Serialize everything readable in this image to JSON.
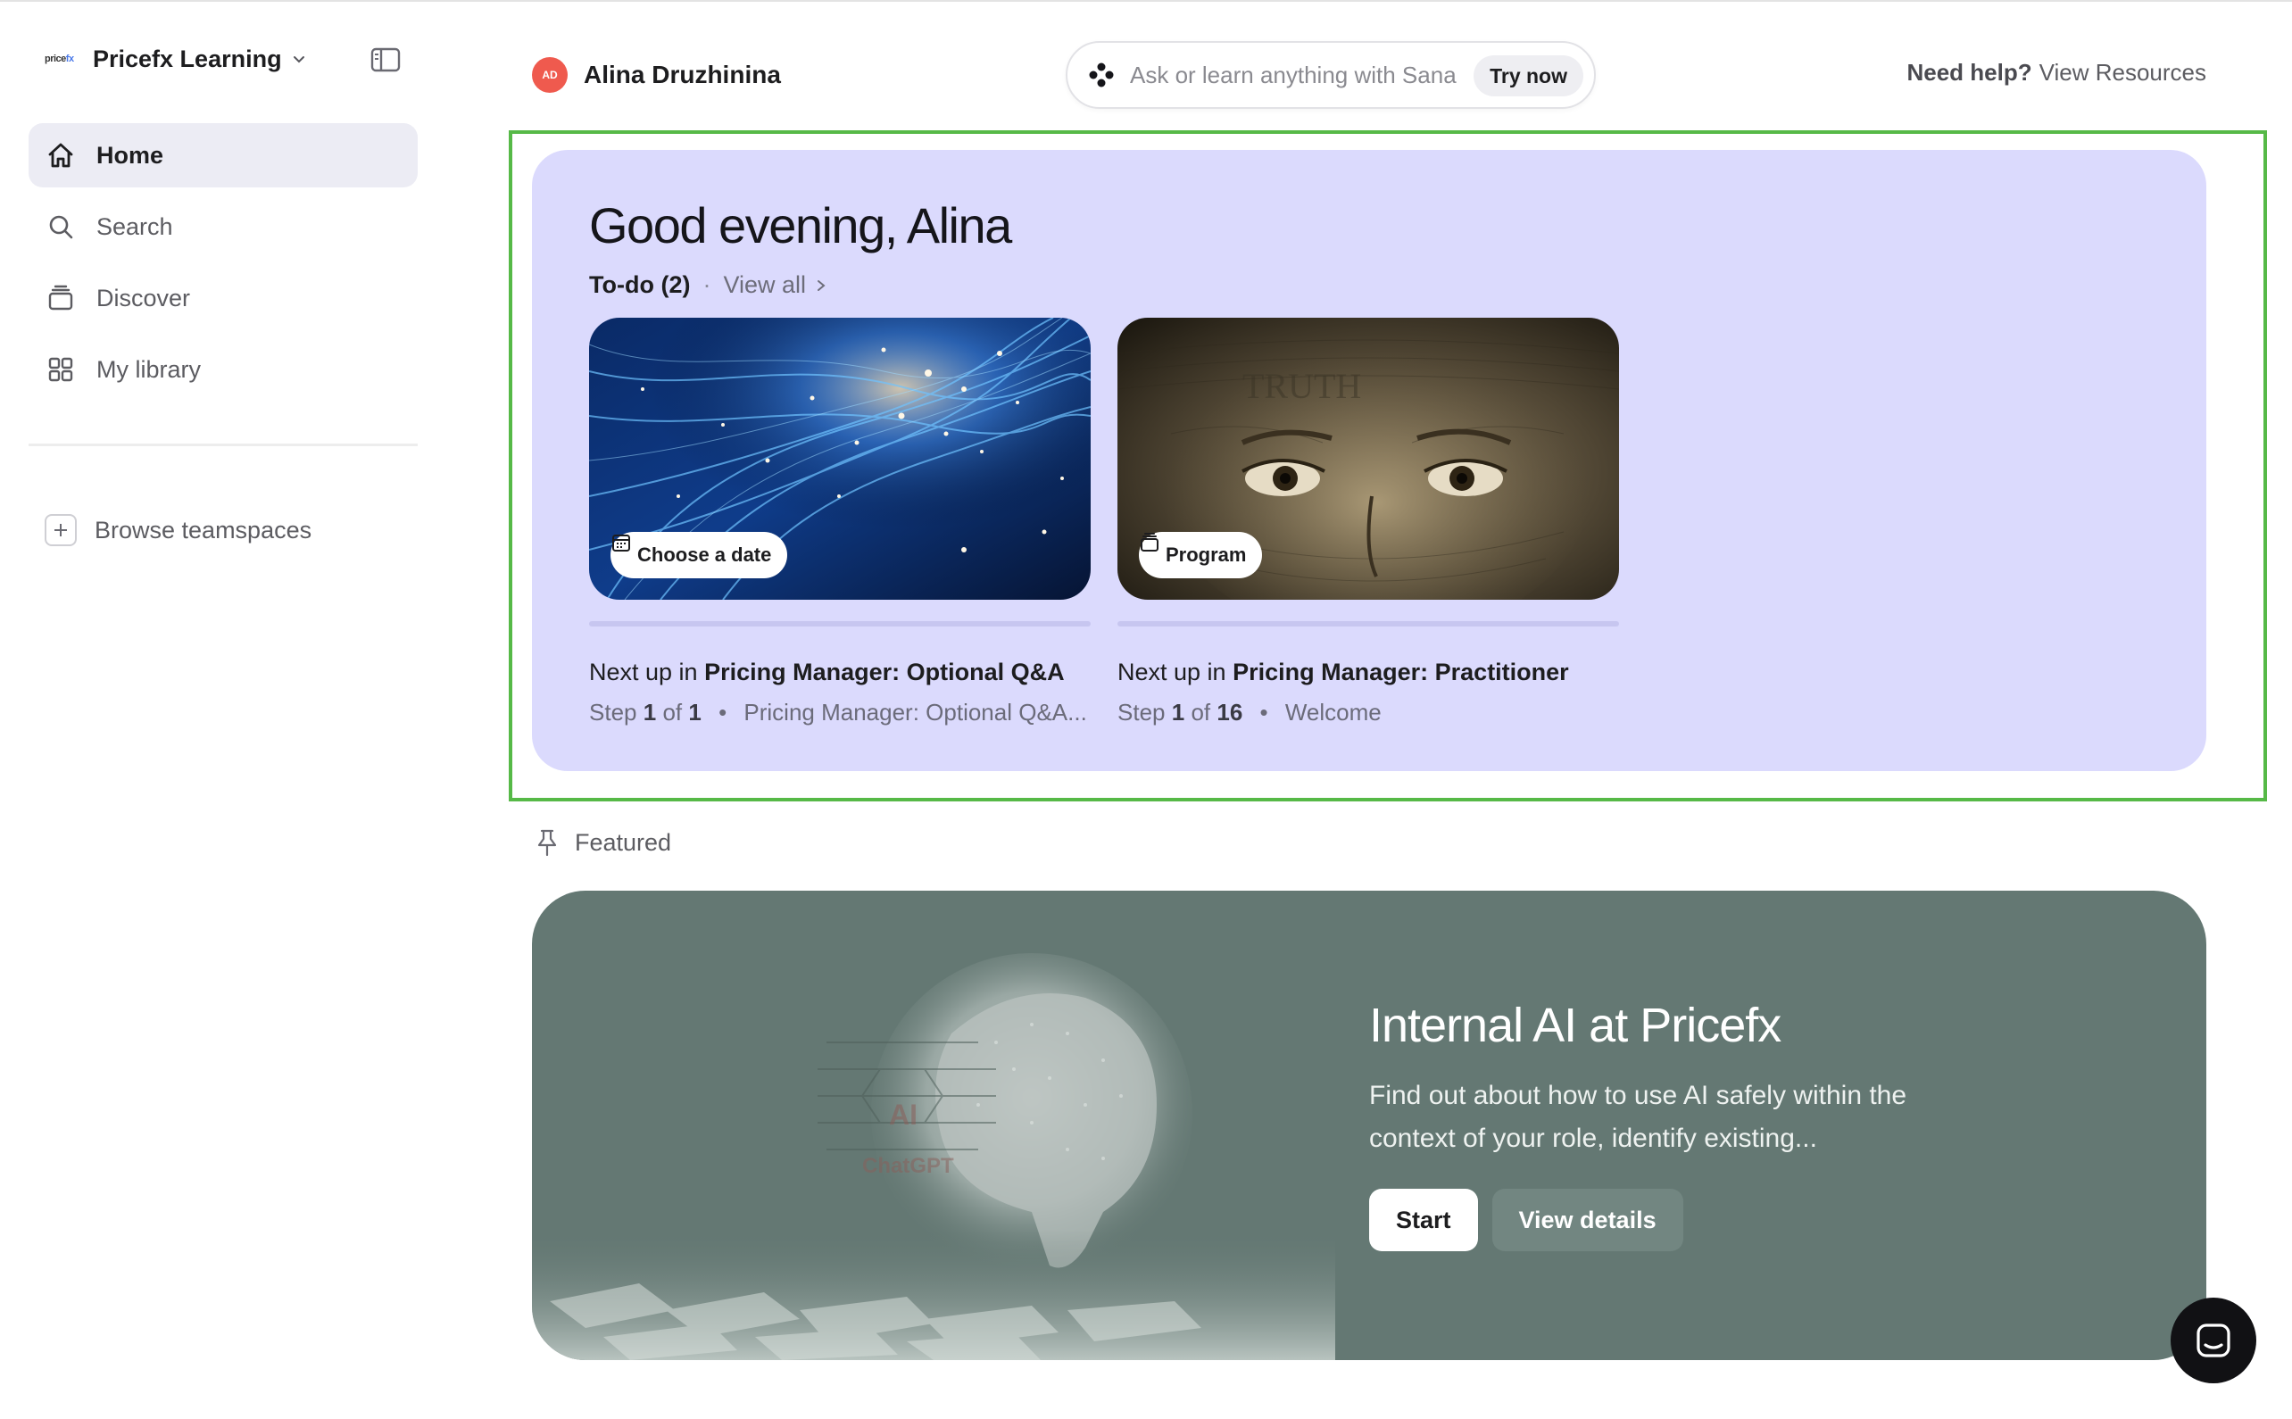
{
  "sidebar": {
    "brand": {
      "logo_text": "pricefx",
      "name": "Pricefx Learning"
    },
    "items": [
      {
        "label": "Home",
        "icon": "home-icon",
        "active": true
      },
      {
        "label": "Search",
        "icon": "search-icon",
        "active": false
      },
      {
        "label": "Discover",
        "icon": "discover-icon",
        "active": false
      },
      {
        "label": "My library",
        "icon": "library-grid-icon",
        "active": false
      }
    ],
    "browse_label": "Browse teamspaces"
  },
  "header": {
    "user": {
      "initials": "AD",
      "name": "Alina Druzhinina"
    },
    "sana": {
      "placeholder": "Ask or learn anything with Sana",
      "try_label": "Try now"
    },
    "help": {
      "prefix": "Need help?",
      "link": "View Resources"
    }
  },
  "greeting": {
    "title": "Good evening, Alina",
    "todo_label": "To-do (2)",
    "separator": "·",
    "view_all": "View all"
  },
  "cards": [
    {
      "pill": "Choose a date",
      "pill_icon": "calendar-icon",
      "next_prefix": "Next up in",
      "next_title": "Pricing Manager: Optional Q&A",
      "step_word": "Step",
      "step_current": "1",
      "step_of": "of",
      "step_total": "1",
      "bullet": "•",
      "step_name": "Pricing Manager: Optional Q&A...",
      "progress": 0
    },
    {
      "pill": "Program",
      "pill_icon": "program-stack-icon",
      "next_prefix": "Next up in",
      "next_title": "Pricing Manager: Practitioner",
      "step_word": "Step",
      "step_current": "1",
      "step_of": "of",
      "step_total": "16",
      "bullet": "•",
      "step_name": "Welcome",
      "progress": 0
    }
  ],
  "featured": {
    "label": "Featured",
    "title": "Internal AI at Pricefx",
    "description": "Find out about how to use AI safely within the context of your role, identify existing...",
    "start_label": "Start",
    "details_label": "View details",
    "image_text_1": "AI",
    "image_text_2": "ChatGPT"
  },
  "colors": {
    "accent_panel": "#dbdafd",
    "highlight_frame": "#56b947",
    "feature_bg": "#647873",
    "avatar_bg": "#ef5a4e"
  }
}
